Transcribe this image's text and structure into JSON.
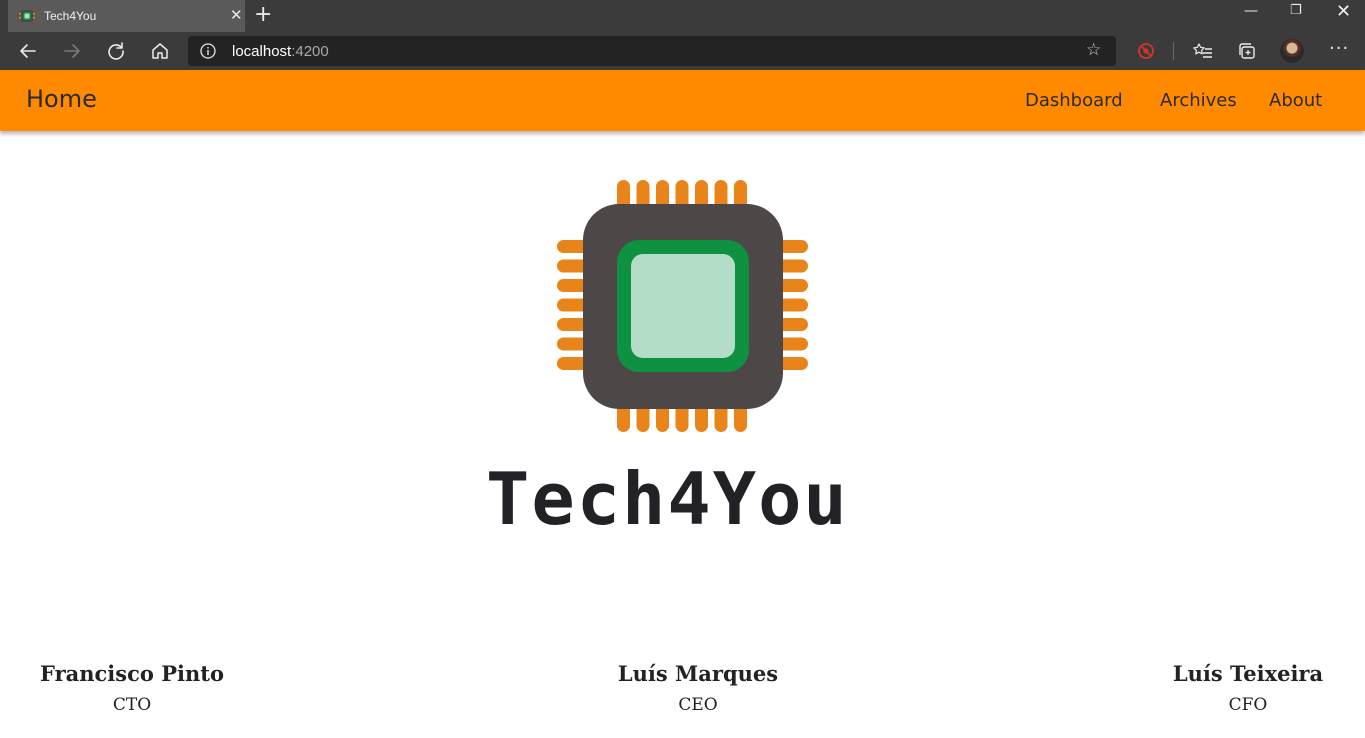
{
  "browser": {
    "tab_title": "Tech4You",
    "tab_close": "✕",
    "new_tab": "+",
    "url_host": "localhost",
    "url_port": ":4200",
    "window_minimize": "—",
    "window_restore": "❐",
    "window_close": "✕",
    "more": "···",
    "star": "☆"
  },
  "navbar": {
    "home": "Home",
    "links": [
      "Dashboard",
      "Archives",
      "About"
    ],
    "color": "#ff8a00"
  },
  "brand": {
    "name": "Tech4You",
    "chip_colors": {
      "pins": "#e8841a",
      "body": "#4d4748",
      "frame": "#0e9140",
      "core": "#b4ddc8"
    }
  },
  "team": [
    {
      "name": "Francisco Pinto",
      "role": "CTO"
    },
    {
      "name": "Luís Marques",
      "role": "CEO"
    },
    {
      "name": "Luís Teixeira",
      "role": "CFO"
    }
  ]
}
